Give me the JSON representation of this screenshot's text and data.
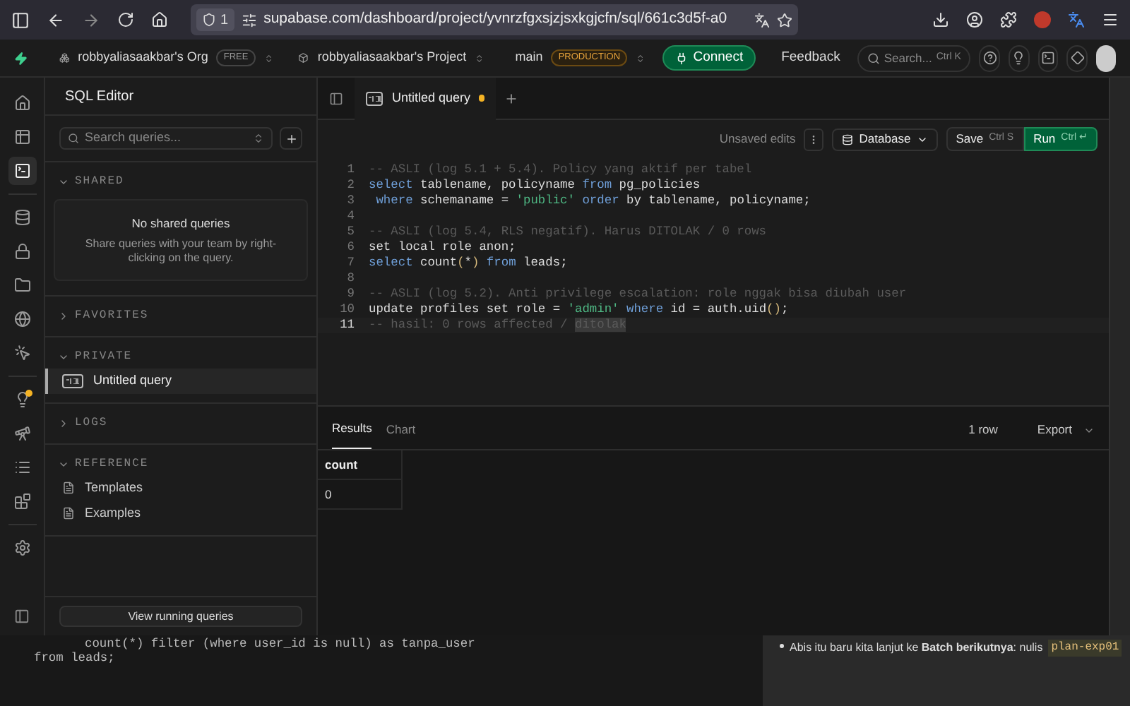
{
  "browser": {
    "shield_count": "1",
    "url": "supabase.com/dashboard/project/yvnrzfgxsjzjsxkgjcfn/sql/661c3d5f-a0"
  },
  "app_header": {
    "org": {
      "name": "robbyaliasaakbar's Org",
      "plan": "FREE"
    },
    "project": {
      "name": "robbyaliasaakbar's Project"
    },
    "branch": {
      "name": "main",
      "env": "PRODUCTION"
    },
    "connect": "Connect",
    "feedback": "Feedback",
    "search": {
      "placeholder": "Search...",
      "shortcut": "Ctrl K"
    }
  },
  "rail": [
    {
      "kind": "home",
      "selected": false
    },
    {
      "kind": "table",
      "selected": false
    },
    {
      "kind": "sql",
      "selected": true
    },
    {
      "kind": "sep"
    },
    {
      "kind": "database",
      "selected": false
    },
    {
      "kind": "lock",
      "selected": false
    },
    {
      "kind": "folder",
      "selected": false
    },
    {
      "kind": "globe",
      "selected": false
    },
    {
      "kind": "cursor",
      "selected": false
    },
    {
      "kind": "sep"
    },
    {
      "kind": "bulb",
      "selected": false,
      "alert": true
    },
    {
      "kind": "telescope",
      "selected": false
    },
    {
      "kind": "list",
      "selected": false
    },
    {
      "kind": "blocks",
      "selected": false
    },
    {
      "kind": "sep"
    },
    {
      "kind": "settings",
      "selected": false
    }
  ],
  "sidebar": {
    "title": "SQL Editor",
    "search": {
      "placeholder": "Search queries..."
    },
    "sections": [
      {
        "title": "SHARED",
        "expanded": true,
        "empty": {
          "title": "No shared queries",
          "text": "Share queries with your team by right-clicking on the query."
        }
      },
      {
        "title": "FAVORITES",
        "expanded": false
      },
      {
        "title": "PRIVATE",
        "expanded": true,
        "items": [
          {
            "kind": "query",
            "label": "Untitled query",
            "selected": true
          }
        ]
      },
      {
        "title": "LOGS",
        "expanded": false
      },
      {
        "title": "REFERENCE",
        "expanded": true,
        "items": [
          {
            "kind": "doc",
            "label": "Templates",
            "selected": false
          },
          {
            "kind": "doc",
            "label": "Examples",
            "selected": false
          }
        ]
      }
    ],
    "footer_button": "View running queries"
  },
  "editor": {
    "tabs": [
      {
        "label": "Untitled query",
        "selected": true,
        "unsaved": true
      }
    ],
    "toolbar": {
      "status": "Unsaved edits",
      "source": "Database",
      "save": {
        "label": "Save",
        "shortcut": "Ctrl S"
      },
      "run": {
        "label": "Run",
        "shortcut": "Ctrl ↵"
      }
    },
    "lines": [
      {
        "n": "1",
        "active": false,
        "tokens": [
          {
            "kind": "cm",
            "text": "-- ASLI (log 5.1 + 5.4). Policy yang aktif per tabel"
          }
        ]
      },
      {
        "n": "2",
        "active": false,
        "tokens": [
          {
            "kind": "kw",
            "text": "select"
          },
          {
            "kind": "id",
            "text": " tablename, policyname "
          },
          {
            "kind": "kw",
            "text": "from"
          },
          {
            "kind": "id",
            "text": " pg_policies"
          }
        ]
      },
      {
        "n": "3",
        "active": false,
        "tokens": [
          {
            "kind": "kw",
            "text": " where"
          },
          {
            "kind": "id",
            "text": " schemaname = "
          },
          {
            "kind": "str",
            "text": "'public'"
          },
          {
            "kind": "kw",
            "text": " order"
          },
          {
            "kind": "id",
            "text": " by tablename, policyname;"
          }
        ]
      },
      {
        "n": "4",
        "active": false
      },
      {
        "n": "5",
        "active": false,
        "tokens": [
          {
            "kind": "cm",
            "text": "-- ASLI (log 5.4, RLS negatif). Harus DITOLAK / 0 rows"
          }
        ]
      },
      {
        "n": "6",
        "active": false,
        "tokens": [
          {
            "kind": "id",
            "text": "set local role anon;"
          }
        ]
      },
      {
        "n": "7",
        "active": false,
        "tokens": [
          {
            "kind": "kw",
            "text": "select"
          },
          {
            "kind": "id",
            "text": " count"
          },
          {
            "kind": "pn",
            "text": "("
          },
          {
            "kind": "op",
            "text": "*"
          },
          {
            "kind": "pn",
            "text": ")"
          },
          {
            "kind": "kw",
            "text": " from"
          },
          {
            "kind": "id",
            "text": " leads;"
          }
        ]
      },
      {
        "n": "8",
        "active": false
      },
      {
        "n": "9",
        "active": false,
        "tokens": [
          {
            "kind": "cm",
            "text": "-- ASLI (log 5.2). Anti privilege escalation: role nggak bisa diubah user"
          }
        ]
      },
      {
        "n": "10",
        "active": false,
        "tokens": [
          {
            "kind": "id",
            "text": "update profiles set role = "
          },
          {
            "kind": "str",
            "text": "'admin'"
          },
          {
            "kind": "kw",
            "text": " where"
          },
          {
            "kind": "id",
            "text": " id = auth.uid"
          },
          {
            "kind": "pn",
            "text": "()"
          },
          {
            "kind": "id",
            "text": ";"
          }
        ]
      },
      {
        "n": "11",
        "active": true,
        "tokens": [
          {
            "kind": "cm",
            "text": "-- hasil: 0 rows affected / "
          },
          {
            "kind": "sel",
            "text": "ditolak"
          }
        ]
      }
    ]
  },
  "results": {
    "tabs": [
      {
        "label": "Results",
        "selected": true
      },
      {
        "label": "Chart",
        "selected": false
      }
    ],
    "row_count": "1 row",
    "export": "Export",
    "columns": [
      "count"
    ],
    "rows": [
      [
        "0"
      ]
    ]
  },
  "background_window": {
    "code_lines": [
      "count(*) filter (where user_id is null) as tanpa_user",
      "from leads;"
    ],
    "chat_bullet": "Abis itu baru kita lanjut ke **Batch berikutnya**: nulis",
    "chat_code": "plan-exp01"
  }
}
